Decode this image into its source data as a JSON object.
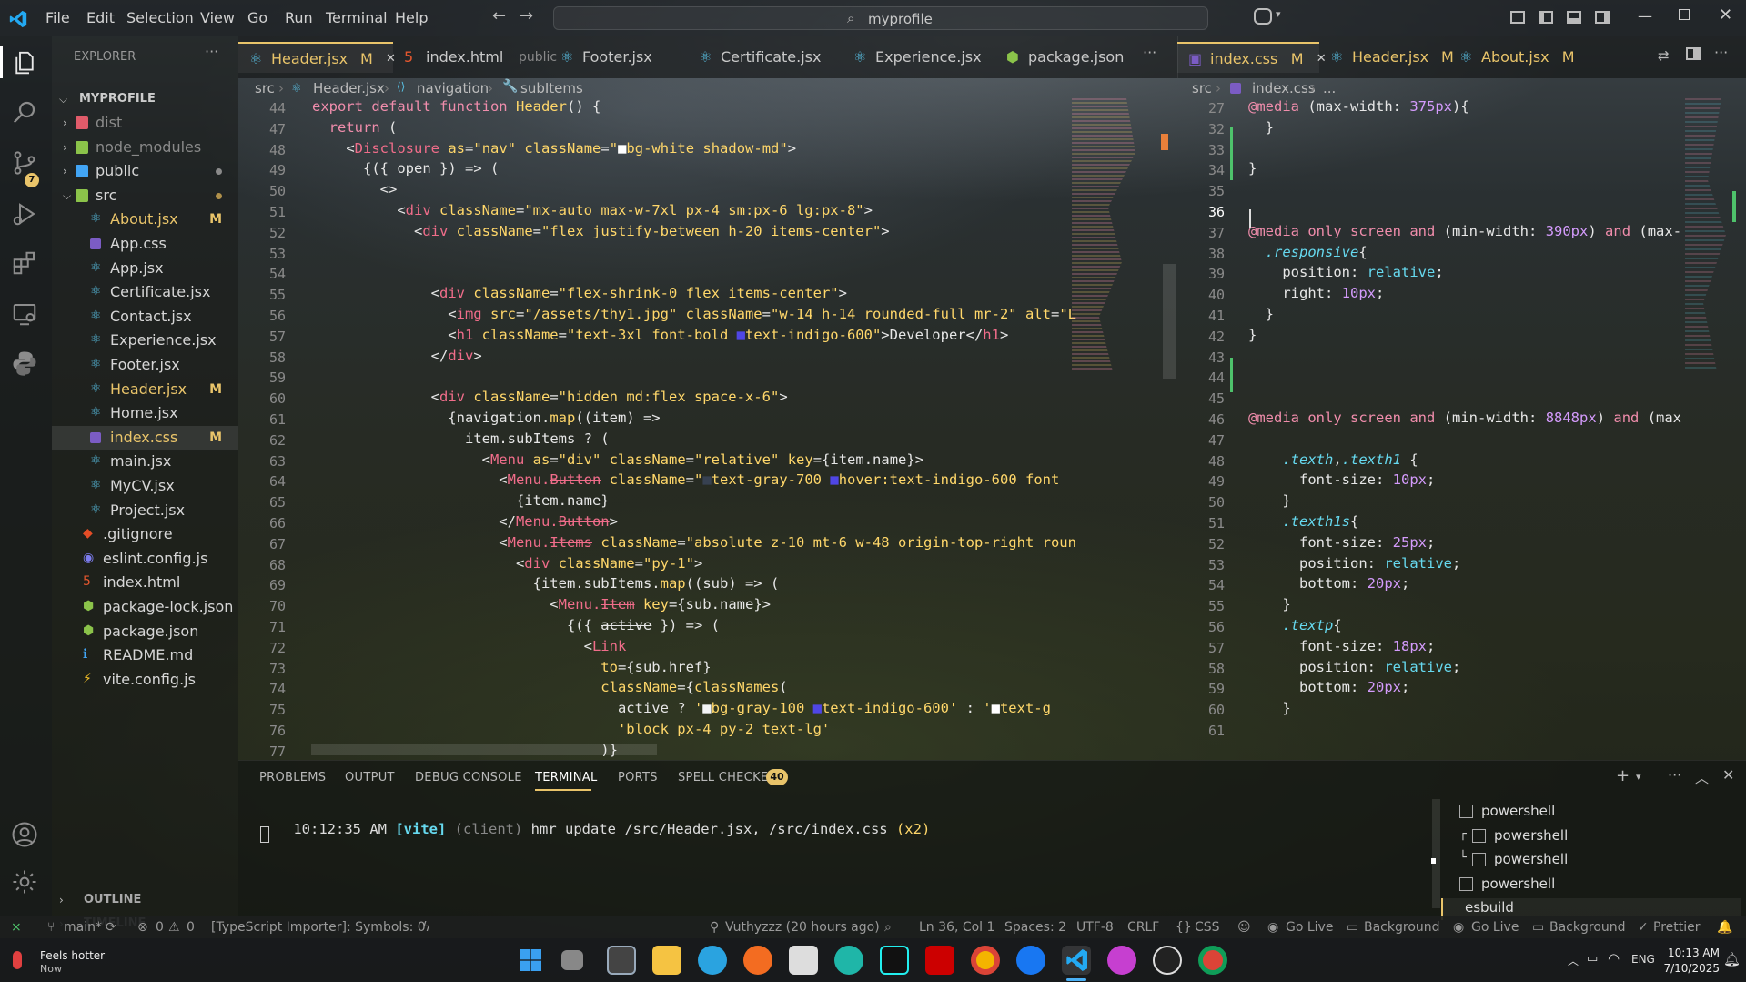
{
  "app": {
    "search": "myprofile"
  },
  "menu": [
    "File",
    "Edit",
    "Selection",
    "View",
    "Go",
    "Run",
    "Terminal",
    "Help"
  ],
  "explorer": {
    "title": "EXPLORER",
    "project": "MYPROFILE",
    "items": [
      {
        "label": "dist",
        "type": "folder",
        "color": "#e05b6a",
        "dim": true
      },
      {
        "label": "node_modules",
        "type": "folder",
        "color": "#8bc34a",
        "dim": true
      },
      {
        "label": "public",
        "type": "folder",
        "color": "#42a5f5",
        "dot": true
      },
      {
        "label": "src",
        "type": "folder-open",
        "color": "#8bc34a",
        "dot": true
      },
      {
        "label": "About.jsx",
        "type": "react",
        "status": "M"
      },
      {
        "label": "App.css",
        "type": "css"
      },
      {
        "label": "App.jsx",
        "type": "react"
      },
      {
        "label": "Certificate.jsx",
        "type": "react"
      },
      {
        "label": "Contact.jsx",
        "type": "react"
      },
      {
        "label": "Experience.jsx",
        "type": "react"
      },
      {
        "label": "Footer.jsx",
        "type": "react"
      },
      {
        "label": "Header.jsx",
        "type": "react",
        "status": "M"
      },
      {
        "label": "Home.jsx",
        "type": "react"
      },
      {
        "label": "index.css",
        "type": "css",
        "status": "M",
        "selected": true
      },
      {
        "label": "main.jsx",
        "type": "react"
      },
      {
        "label": "MyCV.jsx",
        "type": "react"
      },
      {
        "label": "Project.jsx",
        "type": "react"
      },
      {
        "label": ".gitignore",
        "type": "git"
      },
      {
        "label": "eslint.config.js",
        "type": "eslint"
      },
      {
        "label": "index.html",
        "type": "html"
      },
      {
        "label": "package-lock.json",
        "type": "node"
      },
      {
        "label": "package.json",
        "type": "node"
      },
      {
        "label": "README.md",
        "type": "info"
      },
      {
        "label": "vite.config.js",
        "type": "vite"
      }
    ],
    "outline": "OUTLINE",
    "timeline": "TIMELINE",
    "scm_badge": "7"
  },
  "left_tabs": [
    {
      "label": "Header.jsx",
      "status": "M",
      "active": true
    },
    {
      "label": "index.html",
      "suffix": "public"
    },
    {
      "label": "Footer.jsx"
    },
    {
      "label": "Certificate.jsx"
    },
    {
      "label": "Experience.jsx"
    },
    {
      "label": "package.json"
    }
  ],
  "right_tabs": [
    {
      "label": "index.css",
      "status": "M",
      "active": true
    },
    {
      "label": "Header.jsx",
      "status": "M"
    },
    {
      "label": "About.jsx",
      "status": "M"
    }
  ],
  "left_breadcrumb": [
    "src",
    "Header.jsx",
    "navigation",
    "subItems"
  ],
  "right_breadcrumb": [
    "src",
    "index.css",
    "..."
  ],
  "left_code": [
    {
      "n": "44",
      "html": "<span class='k'>export default function</span> <span class='f'>Header</span>() {"
    },
    {
      "n": "47",
      "html": "  <span class='k'>return</span> ("
    },
    {
      "n": "48",
      "html": "    &lt;<span class='t'>Disclosure</span> <span class='a'>as</span>=<span class='s'>\"nav\"</span> <span class='a'>className</span>=<span class='s'>\"</span><span style='color:#fff'>■</span><span class='s'>bg-white shadow-md\"</span>&gt;"
    },
    {
      "n": "49",
      "html": "      {({ <span class='prop'>open</span> }) =&gt; ("
    },
    {
      "n": "50",
      "html": "        &lt;&gt;"
    },
    {
      "n": "51",
      "html": "          &lt;<span class='t'>div</span> <span class='a'>className</span>=<span class='s'>\"mx-auto max-w-7xl px-4 sm:px-6 lg:px-8\"</span>&gt;"
    },
    {
      "n": "52",
      "html": "            &lt;<span class='t'>div</span> <span class='a'>className</span>=<span class='s'>\"flex justify-between h-20 items-center\"</span>&gt;"
    },
    {
      "n": "53",
      "html": ""
    },
    {
      "n": "54",
      "html": ""
    },
    {
      "n": "55",
      "html": "              &lt;<span class='t'>div</span> <span class='a'>className</span>=<span class='s'>\"flex-shrink-0 flex items-center\"</span>&gt;"
    },
    {
      "n": "56",
      "html": "                &lt;<span class='t'>img</span> <span class='a'>src</span>=<span class='s'>\"/assets/thy1.jpg\"</span> <span class='a'>className</span>=<span class='s'>\"w-14 h-14 rounded-full mr-2\"</span> <span class='a'>alt</span>=<span class='s'>\"L</span>"
    },
    {
      "n": "57",
      "html": "                &lt;<span class='t'>h1</span> <span class='a'>className</span>=<span class='s'>\"text-3xl font-bold </span><span style='color:#4f46e5'>■</span><span class='s'>text-indigo-600\"</span>&gt;Developer&lt;/<span class='t'>h1</span>&gt;"
    },
    {
      "n": "58",
      "html": "              &lt;/<span class='t'>div</span>&gt;"
    },
    {
      "n": "59",
      "html": ""
    },
    {
      "n": "60",
      "html": "              &lt;<span class='t'>div</span> <span class='a'>className</span>=<span class='s'>\"hidden md:flex space-x-6\"</span>&gt;"
    },
    {
      "n": "61",
      "html": "                {<span class='prop'>navigation</span>.<span class='f'>map</span>((<span class='prop'>item</span>) =&gt;"
    },
    {
      "n": "62",
      "html": "                  <span class='prop'>item</span>.<span class='prop'>subItems</span> ? ("
    },
    {
      "n": "63",
      "html": "                    &lt;<span class='t'>Menu</span> <span class='a'>as</span>=<span class='s'>\"div\"</span> <span class='a'>className</span>=<span class='s'>\"relative\"</span> <span class='a'>key</span>={<span class='prop'>item</span>.<span class='prop'>name</span>}&gt;"
    },
    {
      "n": "64",
      "html": "                      &lt;<span class='t'>Menu.<s>Button</s></span> <span class='a'>className</span>=<span class='s'>\"</span><span style='color:#374151'>■</span><span class='s'>text-gray-700 </span><span style='color:#4f46e5'>■</span><span class='s'>hover:text-indigo-600 font</span>"
    },
    {
      "n": "65",
      "html": "                        {<span class='prop'>item</span>.<span class='prop'>name</span>}"
    },
    {
      "n": "66",
      "html": "                      &lt;/<span class='t'>Menu.<s>Button</s></span>&gt;"
    },
    {
      "n": "67",
      "html": "                      &lt;<span class='t'>Menu.<s>Items</s></span> <span class='a'>className</span>=<span class='s'>\"absolute z-10 mt-6 w-48 origin-top-right roun</span>"
    },
    {
      "n": "68",
      "html": "                        &lt;<span class='t'>div</span> <span class='a'>className</span>=<span class='s'>\"py-1\"</span>&gt;"
    },
    {
      "n": "69",
      "html": "                          {<span class='prop'>item</span>.<span class='prop'>subItems</span>.<span class='f'>map</span>((<span class='prop'>sub</span>) =&gt; ("
    },
    {
      "n": "70",
      "html": "                            &lt;<span class='t'>Menu.<s>Item</s></span> <span class='a'>key</span>={<span class='prop'>sub</span>.<span class='prop'>name</span>}&gt;"
    },
    {
      "n": "71",
      "html": "                              {({ <s>active</s> }) =&gt; ("
    },
    {
      "n": "72",
      "html": "                                &lt;<span class='t'>Link</span>"
    },
    {
      "n": "73",
      "html": "                                  <span class='a'>to</span>={<span class='prop'>sub</span>.<span class='prop'>href</span>}"
    },
    {
      "n": "74",
      "html": "                                  <span class='a'>className</span>={<span class='f'>classNames</span>("
    },
    {
      "n": "75",
      "html": "                                    <span class='prop'>active</span> ? <span class='s'>'</span><span style='color:#f3f4f6'>■</span><span class='s'>bg-gray-100 </span><span style='color:#4f46e5'>■</span><span class='s'>text-indigo-600'</span> : <span class='s'>'</span><span style='color:#fff'>■</span><span class='s'>text-g</span>"
    },
    {
      "n": "76",
      "html": "                                    <span class='s'>'block px-4 py-2 text-lg'</span>"
    },
    {
      "n": "77",
      "html": "                                  )}"
    }
  ],
  "right_code": [
    {
      "n": "27",
      "html": "<span class='kw'>@media</span> (<span class='prop'>max-width</span>: <span class='num'>375px</span>){"
    },
    {
      "n": "32",
      "html": "  }"
    },
    {
      "n": "33",
      "html": ""
    },
    {
      "n": "34",
      "html": "}"
    },
    {
      "n": "35",
      "html": ""
    },
    {
      "n": "36",
      "html": ""
    },
    {
      "n": "37",
      "html": "<span class='kw'>@media only</span> <span class='kw'>screen</span> <span class='kw'>and</span> (<span class='prop'>min-width</span>: <span class='num'>390px</span>) <span class='kw'>and</span> (max-"
    },
    {
      "n": "38",
      "html": "  <span class='sel'><i>.responsive</i></span>{"
    },
    {
      "n": "39",
      "html": "    <span class='prop'>position</span>: <span class='sel'>relative</span>;"
    },
    {
      "n": "40",
      "html": "    <span class='prop'>right</span>: <span class='num'>10px</span>;"
    },
    {
      "n": "41",
      "html": "  }"
    },
    {
      "n": "42",
      "html": "}"
    },
    {
      "n": "43",
      "html": ""
    },
    {
      "n": "44",
      "html": ""
    },
    {
      "n": "45",
      "html": ""
    },
    {
      "n": "46",
      "html": "<span class='kw'>@media only</span> <span class='kw'>screen</span> <span class='kw'>and</span> (<span class='prop'>min-width</span>: <span class='num'>8848px</span>) <span class='kw'>and</span> (max"
    },
    {
      "n": "47",
      "html": ""
    },
    {
      "n": "48",
      "html": "    <span class='sel'><i>.texth</i></span>,<span class='sel'><i>.texth1</i></span> {"
    },
    {
      "n": "49",
      "html": "      <span class='prop'>font-size</span>: <span class='num'>10px</span>;"
    },
    {
      "n": "50",
      "html": "    }"
    },
    {
      "n": "51",
      "html": "    <span class='sel'><i>.texth1s</i></span>{"
    },
    {
      "n": "52",
      "html": "      <span class='prop'>font-size</span>: <span class='num'>25px</span>;"
    },
    {
      "n": "53",
      "html": "      <span class='prop'>position</span>: <span class='sel'>relative</span>;"
    },
    {
      "n": "54",
      "html": "      <span class='prop'>bottom</span>: <span class='num'>20px</span>;"
    },
    {
      "n": "55",
      "html": "    }"
    },
    {
      "n": "56",
      "html": "    <span class='sel'><i>.textp</i></span>{"
    },
    {
      "n": "57",
      "html": "      <span class='prop'>font-size</span>: <span class='num'>18px</span>;"
    },
    {
      "n": "58",
      "html": "      <span class='prop'>position</span>: <span class='sel'>relative</span>;"
    },
    {
      "n": "59",
      "html": "      <span class='prop'>bottom</span>: <span class='num'>20px</span>;"
    },
    {
      "n": "60",
      "html": "    }"
    },
    {
      "n": "61",
      "html": ""
    }
  ],
  "panel": {
    "tabs": [
      "PROBLEMS",
      "OUTPUT",
      "DEBUG CONSOLE",
      "TERMINAL",
      "PORTS",
      "SPELL CHECKER"
    ],
    "active_tab": "TERMINAL",
    "spell_badge": "40",
    "terminal_time": "10:12:35 AM",
    "terminal_vite": "[vite]",
    "terminal_client": "(client)",
    "terminal_msg": "hmr update /src/Header.jsx, /src/index.css",
    "terminal_count": "(x2)",
    "shells": [
      "powershell",
      "powershell",
      "powershell",
      "powershell",
      "esbuild"
    ]
  },
  "status": {
    "branch": "main*",
    "errors": "0",
    "warnings": "0",
    "ts": "[TypeScript Importer]: Symbols: 0",
    "blame": "Vuthyzzz (20 hours ago)",
    "position": "Ln 36, Col 1",
    "spaces": "Spaces: 2",
    "encoding": "UTF-8",
    "eol": "CRLF",
    "lang": "CSS",
    "golive1": "Go Live",
    "bg1": "Background",
    "golive2": "Go Live",
    "bg2": "Background",
    "prettier": "Prettier"
  },
  "taskbar": {
    "weather_title": "Feels hotter",
    "weather_sub": "Now",
    "lang": "ENG",
    "time": "10:13 AM",
    "date": "7/10/2025"
  }
}
